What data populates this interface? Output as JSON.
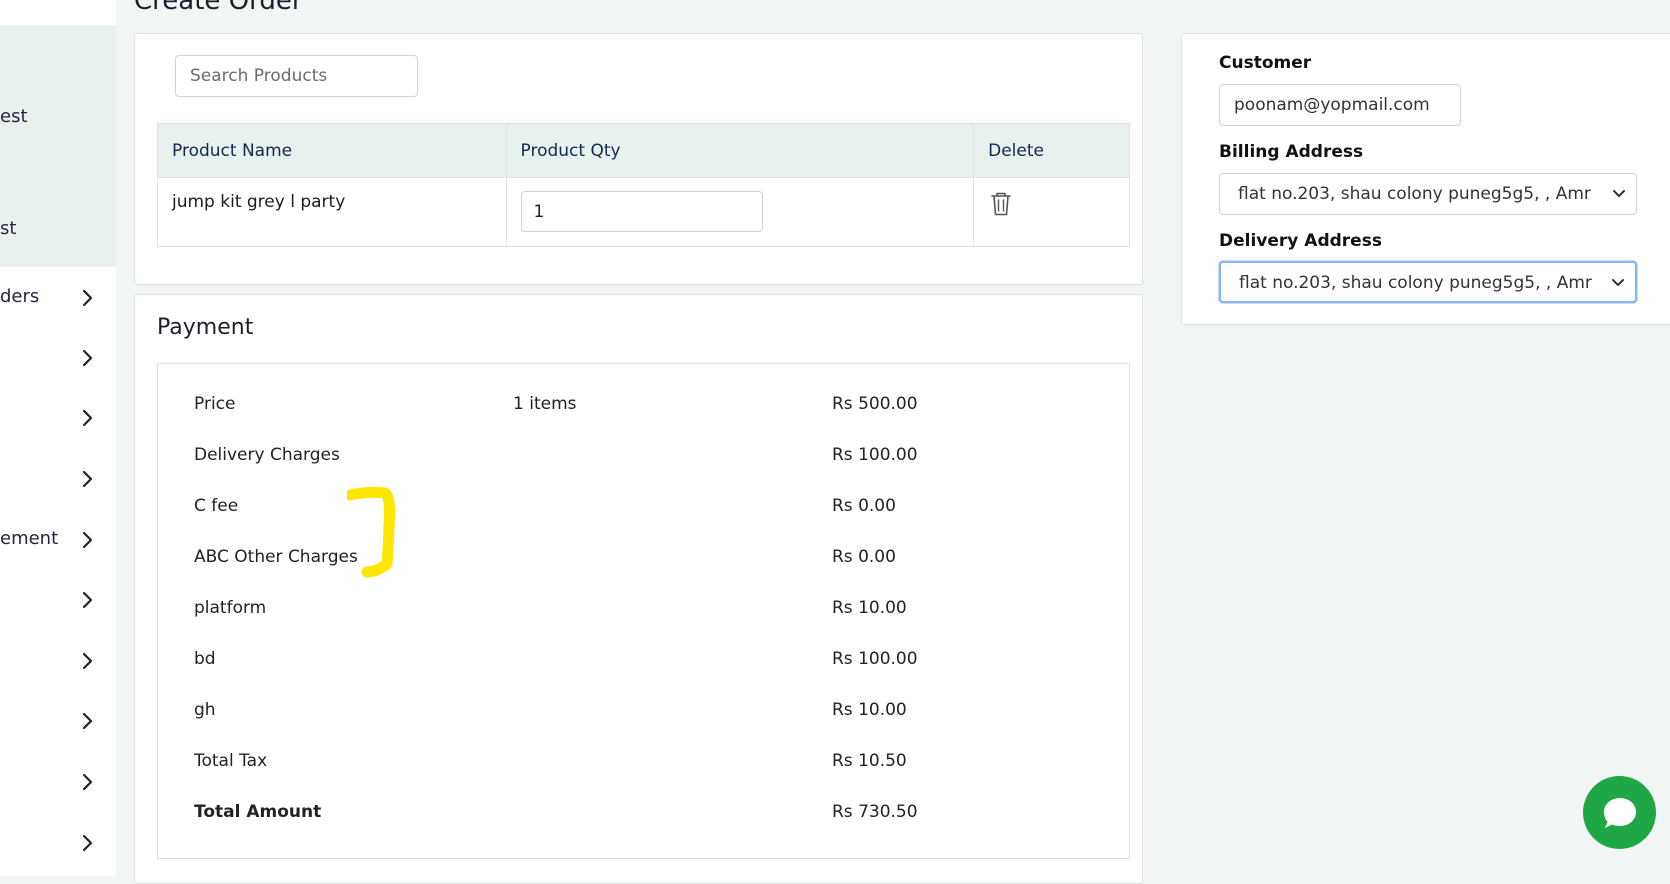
{
  "page": {
    "title": "Create Order"
  },
  "sidebar": {
    "items": [
      {
        "label": "est",
        "has_chevron": false
      },
      {
        "label": "st",
        "has_chevron": false
      },
      {
        "label": "ders",
        "has_chevron": true
      },
      {
        "label": "",
        "has_chevron": true
      },
      {
        "label": "",
        "has_chevron": true
      },
      {
        "label": "",
        "has_chevron": true
      },
      {
        "label": "ement",
        "has_chevron": true
      },
      {
        "label": "",
        "has_chevron": true
      },
      {
        "label": "",
        "has_chevron": true
      },
      {
        "label": "",
        "has_chevron": true
      },
      {
        "label": "",
        "has_chevron": true
      },
      {
        "label": "",
        "has_chevron": true
      }
    ]
  },
  "products": {
    "search_placeholder": "Search Products",
    "columns": [
      "Product Name",
      "Product Qty",
      "Delete"
    ],
    "rows": [
      {
        "name": "jump kit grey l party",
        "qty": "1"
      }
    ]
  },
  "payment": {
    "title": "Payment",
    "rows": [
      {
        "label": "Price",
        "detail": "1 items",
        "amount": "Rs 500.00"
      },
      {
        "label": "Delivery Charges",
        "detail": "",
        "amount": "Rs 100.00"
      },
      {
        "label": "C fee",
        "detail": "",
        "amount": "Rs 0.00"
      },
      {
        "label": "ABC Other Charges",
        "detail": "",
        "amount": "Rs 0.00"
      },
      {
        "label": "platform",
        "detail": "",
        "amount": "Rs 10.00"
      },
      {
        "label": "bd",
        "detail": "",
        "amount": "Rs 100.00"
      },
      {
        "label": "gh",
        "detail": "",
        "amount": "Rs 10.00"
      },
      {
        "label": "Total Tax",
        "detail": "",
        "amount": "Rs 10.50"
      },
      {
        "label": "Total Amount",
        "detail": "",
        "amount": "Rs 730.50"
      }
    ]
  },
  "customer": {
    "label": "Customer",
    "email": "poonam@yopmail.com",
    "billing_label": "Billing Address",
    "billing_value": "flat no.203, shau colony puneg5g5, , Amr",
    "delivery_label": "Delivery Address",
    "delivery_value": "flat no.203, shau colony puneg5g5, , Amr"
  },
  "colors": {
    "header_bg": "#e9f1ef",
    "header_text": "#13294b",
    "chat_green": "#1ea744",
    "highlight_yellow": "#ffe600",
    "focus_border": "#87b6f3"
  },
  "icons": {
    "delete": "trash-icon",
    "sidebar_chevron": "chevron-right-icon",
    "chat": "chat-bubble-icon",
    "select_caret": "chevron-down-icon"
  }
}
